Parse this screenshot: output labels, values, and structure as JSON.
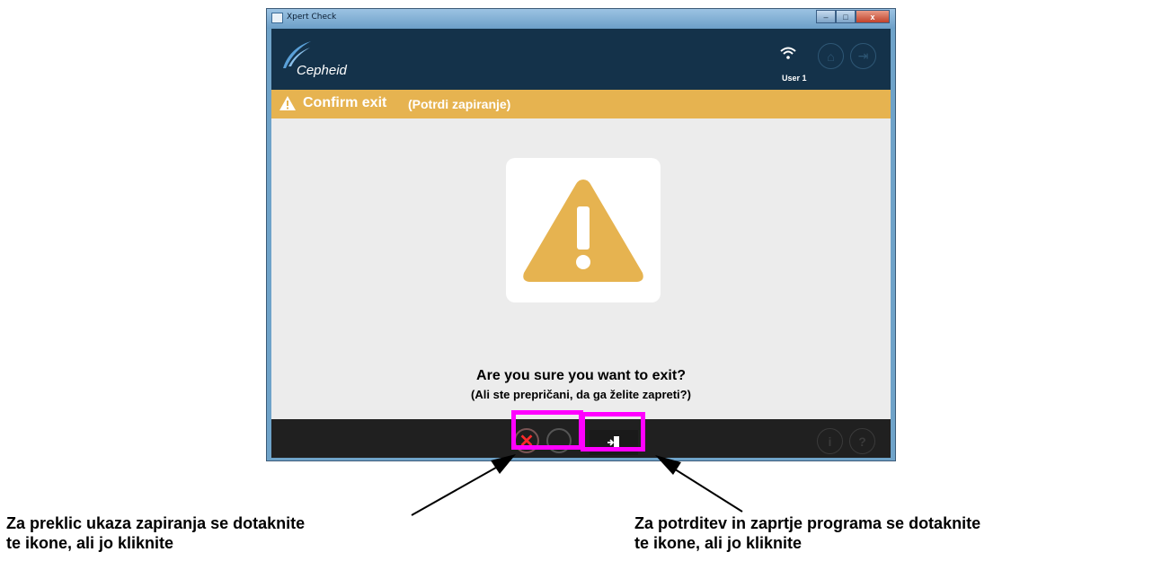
{
  "window": {
    "title": "Xpert Check",
    "minimize_label": "–",
    "maximize_label": "□",
    "close_label": "x"
  },
  "header": {
    "brand": "Cepheid",
    "user": "User 1",
    "icons": [
      "wifi-icon",
      "home-icon",
      "exit-icon"
    ]
  },
  "banner": {
    "title": "Confirm exit",
    "subtitle": "(Potrdi zapiranje)",
    "color": "#e6b350"
  },
  "dialog": {
    "question": "Are you sure you want to exit?",
    "question_translation": "(Ali ste prepričani, da ga želite zapreti?)",
    "warning_color": "#e6b350"
  },
  "footer": {
    "cancel_icon": "x-circle-icon",
    "confirm_icon": "exit-door-icon",
    "info_label": "i",
    "help_label": "?"
  },
  "annotations": {
    "left": {
      "line1": "Za preklic ukaza zapiranja se dotaknite",
      "line2": "te ikone, ali jo kliknite"
    },
    "right": {
      "line1": "Za potrditev in zaprtje programa se dotaknite",
      "line2": "te ikone, ali jo kliknite"
    },
    "highlight_color": "#ff00ff"
  }
}
